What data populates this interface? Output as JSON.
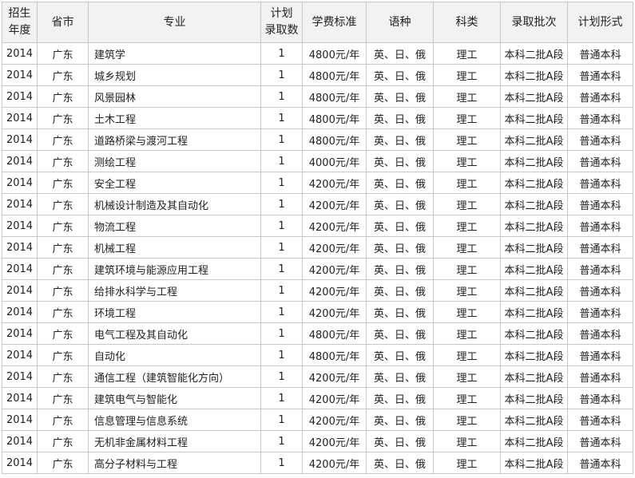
{
  "table": {
    "headers": {
      "year": [
        "招生",
        "年度"
      ],
      "province": "省市",
      "major": "专业",
      "quota": [
        "计划",
        "录取数"
      ],
      "tuition": "学费标准",
      "language": "语种",
      "category": "科类",
      "batch": "录取批次",
      "plan_type": "计划形式"
    },
    "rows": [
      {
        "year": "2014",
        "province": "广东",
        "major": "建筑学",
        "quota": "1",
        "tuition": "4800元/年",
        "language": "英、日、俄",
        "category": "理工",
        "batch": "本科二批A段",
        "plan_type": "普通本科"
      },
      {
        "year": "2014",
        "province": "广东",
        "major": "城乡规划",
        "quota": "1",
        "tuition": "4800元/年",
        "language": "英、日、俄",
        "category": "理工",
        "batch": "本科二批A段",
        "plan_type": "普通本科"
      },
      {
        "year": "2014",
        "province": "广东",
        "major": "风景园林",
        "quota": "1",
        "tuition": "4800元/年",
        "language": "英、日、俄",
        "category": "理工",
        "batch": "本科二批A段",
        "plan_type": "普通本科"
      },
      {
        "year": "2014",
        "province": "广东",
        "major": "土木工程",
        "quota": "1",
        "tuition": "4800元/年",
        "language": "英、日、俄",
        "category": "理工",
        "batch": "本科二批A段",
        "plan_type": "普通本科"
      },
      {
        "year": "2014",
        "province": "广东",
        "major": "道路桥梁与渡河工程",
        "quota": "1",
        "tuition": "4800元/年",
        "language": "英、日、俄",
        "category": "理工",
        "batch": "本科二批A段",
        "plan_type": "普通本科"
      },
      {
        "year": "2014",
        "province": "广东",
        "major": "测绘工程",
        "quota": "1",
        "tuition": "4000元/年",
        "language": "英、日、俄",
        "category": "理工",
        "batch": "本科二批A段",
        "plan_type": "普通本科"
      },
      {
        "year": "2014",
        "province": "广东",
        "major": "安全工程",
        "quota": "1",
        "tuition": "4200元/年",
        "language": "英、日、俄",
        "category": "理工",
        "batch": "本科二批A段",
        "plan_type": "普通本科"
      },
      {
        "year": "2014",
        "province": "广东",
        "major": "机械设计制造及其自动化",
        "quota": "1",
        "tuition": "4200元/年",
        "language": "英、日、俄",
        "category": "理工",
        "batch": "本科二批A段",
        "plan_type": "普通本科"
      },
      {
        "year": "2014",
        "province": "广东",
        "major": "物流工程",
        "quota": "1",
        "tuition": "4200元/年",
        "language": "英、日、俄",
        "category": "理工",
        "batch": "本科二批A段",
        "plan_type": "普通本科"
      },
      {
        "year": "2014",
        "province": "广东",
        "major": "机械工程",
        "quota": "1",
        "tuition": "4200元/年",
        "language": "英、日、俄",
        "category": "理工",
        "batch": "本科二批A段",
        "plan_type": "普通本科"
      },
      {
        "year": "2014",
        "province": "广东",
        "major": "建筑环境与能源应用工程",
        "quota": "1",
        "tuition": "4200元/年",
        "language": "英、日、俄",
        "category": "理工",
        "batch": "本科二批A段",
        "plan_type": "普通本科"
      },
      {
        "year": "2014",
        "province": "广东",
        "major": "给排水科学与工程",
        "quota": "1",
        "tuition": "4200元/年",
        "language": "英、日、俄",
        "category": "理工",
        "batch": "本科二批A段",
        "plan_type": "普通本科"
      },
      {
        "year": "2014",
        "province": "广东",
        "major": "环境工程",
        "quota": "1",
        "tuition": "4200元/年",
        "language": "英、日、俄",
        "category": "理工",
        "batch": "本科二批A段",
        "plan_type": "普通本科"
      },
      {
        "year": "2014",
        "province": "广东",
        "major": "电气工程及其自动化",
        "quota": "1",
        "tuition": "4800元/年",
        "language": "英、日、俄",
        "category": "理工",
        "batch": "本科二批A段",
        "plan_type": "普通本科"
      },
      {
        "year": "2014",
        "province": "广东",
        "major": "自动化",
        "quota": "1",
        "tuition": "4800元/年",
        "language": "英、日、俄",
        "category": "理工",
        "batch": "本科二批A段",
        "plan_type": "普通本科"
      },
      {
        "year": "2014",
        "province": "广东",
        "major": "通信工程（建筑智能化方向）",
        "quota": "1",
        "tuition": "4200元/年",
        "language": "英、日、俄",
        "category": "理工",
        "batch": "本科二批A段",
        "plan_type": "普通本科"
      },
      {
        "year": "2014",
        "province": "广东",
        "major": "建筑电气与智能化",
        "quota": "1",
        "tuition": "4200元/年",
        "language": "英、日、俄",
        "category": "理工",
        "batch": "本科二批A段",
        "plan_type": "普通本科"
      },
      {
        "year": "2014",
        "province": "广东",
        "major": "信息管理与信息系统",
        "quota": "1",
        "tuition": "4200元/年",
        "language": "英、日、俄",
        "category": "理工",
        "batch": "本科二批A段",
        "plan_type": "普通本科"
      },
      {
        "year": "2014",
        "province": "广东",
        "major": "无机非金属材料工程",
        "quota": "1",
        "tuition": "4200元/年",
        "language": "英、日、俄",
        "category": "理工",
        "batch": "本科二批A段",
        "plan_type": "普通本科"
      },
      {
        "year": "2014",
        "province": "广东",
        "major": "高分子材料与工程",
        "quota": "1",
        "tuition": "4200元/年",
        "language": "英、日、俄",
        "category": "理工",
        "batch": "本科二批A段",
        "plan_type": "普通本科"
      }
    ]
  }
}
